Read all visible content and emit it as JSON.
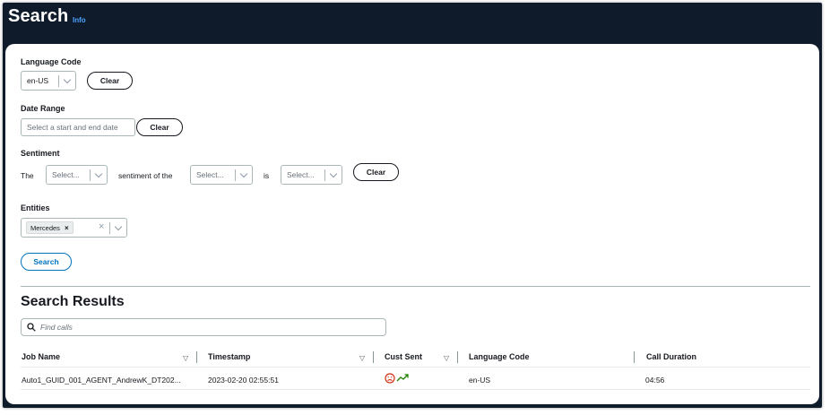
{
  "page": {
    "title": "Search",
    "info_link": "Info"
  },
  "filters": {
    "language_code": {
      "label": "Language Code",
      "value": "en-US",
      "clear_label": "Clear"
    },
    "date_range": {
      "label": "Date Range",
      "placeholder": "Select a start and end date",
      "clear_label": "Clear"
    },
    "sentiment": {
      "label": "Sentiment",
      "prefix": "The",
      "select1_placeholder": "Select...",
      "middle_text": "sentiment of the",
      "select2_placeholder": "Select...",
      "is_text": "is",
      "select3_placeholder": "Select...",
      "clear_label": "Clear"
    },
    "entities": {
      "label": "Entities",
      "tokens": [
        "Mercedes"
      ],
      "clear_glyph": "×"
    },
    "search_button": "Search"
  },
  "results": {
    "heading": "Search Results",
    "find_placeholder": "Find calls",
    "columns": [
      "Job Name",
      "Timestamp",
      "Cust Sent",
      "Language Code",
      "Call Duration"
    ],
    "rows": [
      {
        "job_name": "Auto1_GUID_001_AGENT_AndrewK_DT202...",
        "timestamp": "2023-02-20 02:55:51",
        "cust_sent_icons": [
          "sad-face-icon",
          "trend-up-icon"
        ],
        "language_code": "en-US",
        "call_duration": "04:56"
      }
    ]
  },
  "colors": {
    "header_bg": "#0f1b2a",
    "link_blue": "#4aa3ff",
    "primary_blue": "#0073bb",
    "sentiment_negative": "#d13212",
    "trend_positive": "#1d8102"
  }
}
